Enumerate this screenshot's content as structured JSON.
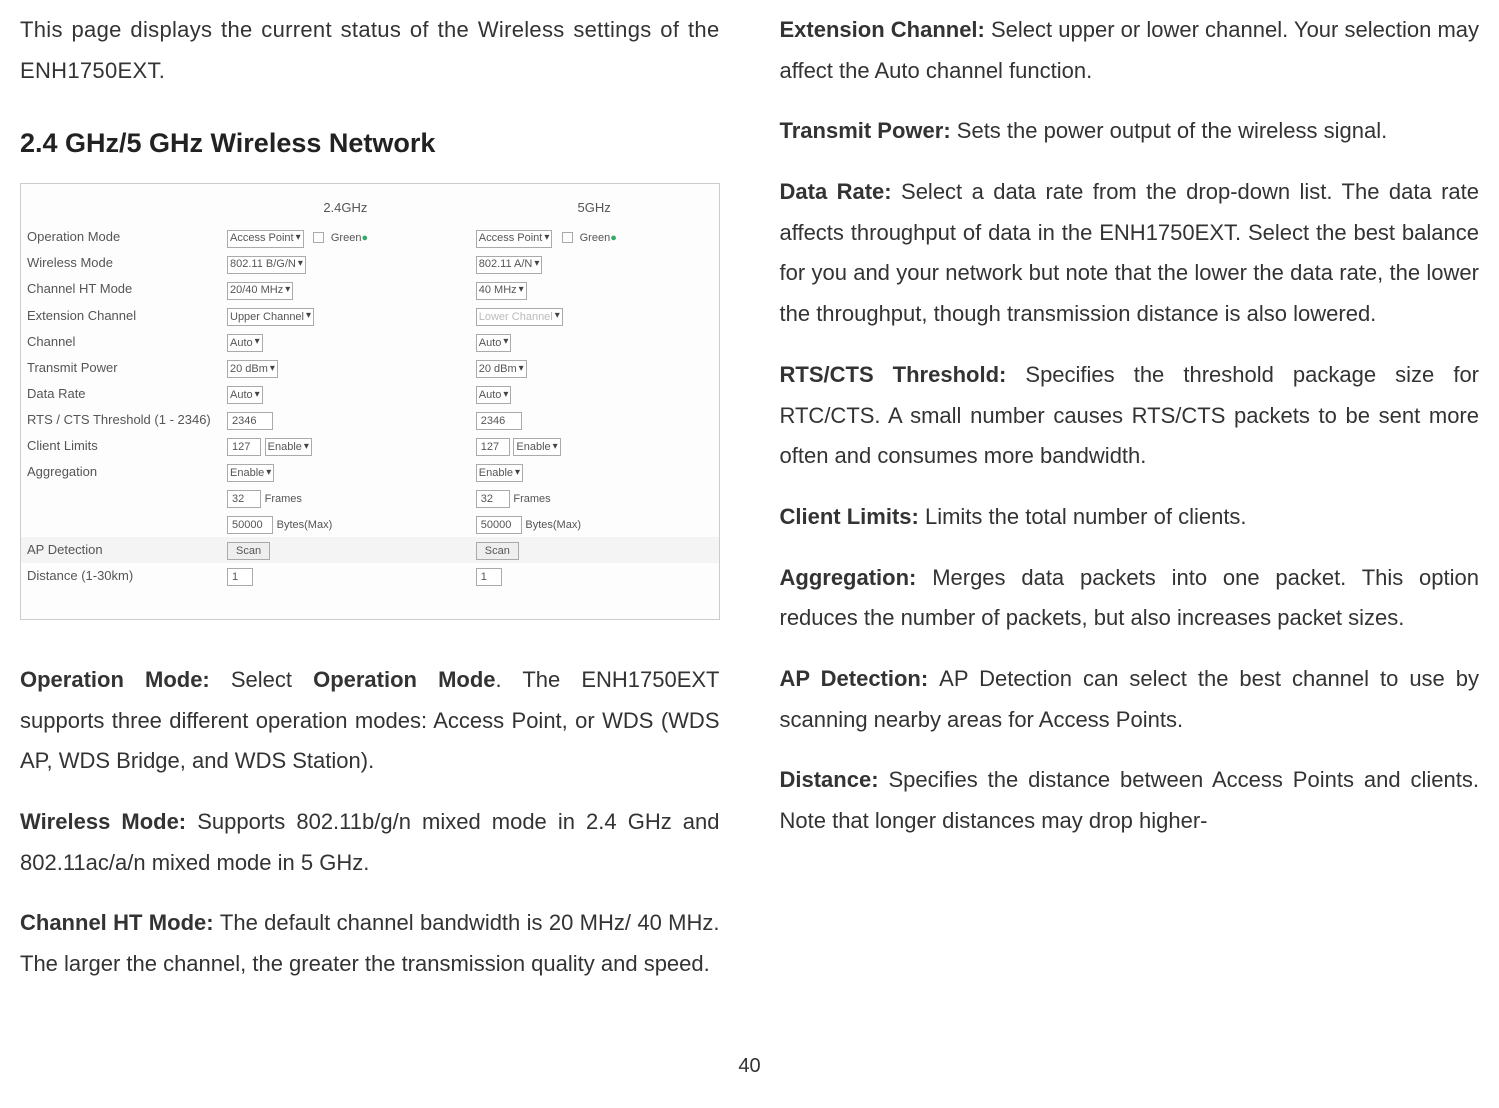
{
  "left": {
    "intro": "This page displays the current status of the Wireless settings of the ENH1750EXT.",
    "heading": "2.4 GHz/5 GHz Wireless Network",
    "fig": {
      "col24": "2.4GHz",
      "col5": "5GHz",
      "rows": {
        "op_mode": "Operation Mode",
        "wireless_mode": "Wireless Mode",
        "ch_ht": "Channel HT Mode",
        "ext_ch": "Extension Channel",
        "channel": "Channel",
        "tx_power": "Transmit Power",
        "data_rate": "Data Rate",
        "rts": "RTS / CTS Threshold (1 - 2346)",
        "climits": "Client Limits",
        "aggreg": "Aggregation",
        "apdet": "AP Detection",
        "distance": "Distance (1-30km)"
      },
      "v24": {
        "op_mode": "Access Point",
        "green": "Green",
        "wireless_mode": "802.11 B/G/N",
        "ch_ht": "20/40 MHz",
        "ext_ch": "Upper Channel",
        "channel": "Auto",
        "tx_power": "20 dBm",
        "data_rate": "Auto",
        "rts": "2346",
        "climits_val": "127",
        "climits_en": "Enable",
        "agg_mode": "Enable",
        "agg_frames": "32",
        "agg_frames_lbl": "Frames",
        "agg_bytes": "50000",
        "agg_bytes_lbl": "Bytes(Max)",
        "scan": "Scan",
        "distance": "1"
      },
      "v5": {
        "op_mode": "Access Point",
        "green": "Green",
        "wireless_mode": "802.11 A/N",
        "ch_ht": "40 MHz",
        "ext_ch": "Lower Channel",
        "channel": "Auto",
        "tx_power": "20 dBm",
        "data_rate": "Auto",
        "rts": "2346",
        "climits_val": "127",
        "climits_en": "Enable",
        "agg_mode": "Enable",
        "agg_frames": "32",
        "agg_frames_lbl": "Frames",
        "agg_bytes": "50000",
        "agg_bytes_lbl": "Bytes(Max)",
        "scan": "Scan",
        "distance": "1"
      }
    },
    "p_op_label": "Operation Mode: ",
    "p_op_pre": "Select ",
    "p_op_bold": "Operation Mode",
    "p_op_post": ". The ENH1750EXT supports three different operation modes: Access Point, or WDS (WDS AP, WDS Bridge, and WDS Station).",
    "p_wm_label": "Wireless Mode: ",
    "p_wm_text": "Supports 802.11b/g/n mixed mode in 2.4 GHz and 802.11ac/a/n mixed mode in 5 GHz.",
    "p_ht_label": "Channel HT Mode: ",
    "p_ht_text": "The default channel bandwidth is 20 MHz/ 40 MHz. The larger the channel, the greater the transmission quality and speed."
  },
  "right": {
    "p_ext_label": "Extension Channel: ",
    "p_ext_text": "Select upper or lower channel. Your selection may affect the Auto channel function.",
    "p_tx_label": "Transmit Power: ",
    "p_tx_text": "Sets the power output of the wireless signal.",
    "p_dr_label": "Data Rate: ",
    "p_dr_text": "Select a data rate from the drop-down list. The data rate affects throughput of data in the ENH1750EXT. Select the best balance for you and your network but note that the lower the data rate, the lower the throughput, though transmission distance is also lowered.",
    "p_rts_label": "RTS/CTS Threshold: ",
    "p_rts_text": "Specifies the threshold package size for RTC/CTS. A small number causes RTS/CTS packets to be sent more often and consumes more bandwidth.",
    "p_cl_label": "Client Limits: ",
    "p_cl_text": "Limits the total number of clients.",
    "p_ag_label": "Aggregation: ",
    "p_ag_text": "Merges data packets into one packet. This option reduces the number of packets, but also increases packet sizes.",
    "p_ap_label": "AP Detection: ",
    "p_ap_text": "AP Detection can select the best channel to use by scanning nearby areas for Access Points.",
    "p_dist_label": "Distance: ",
    "p_dist_text": "Specifies the distance between Access Points and clients. Note that longer distances may drop higher-"
  },
  "pagenum": "40"
}
